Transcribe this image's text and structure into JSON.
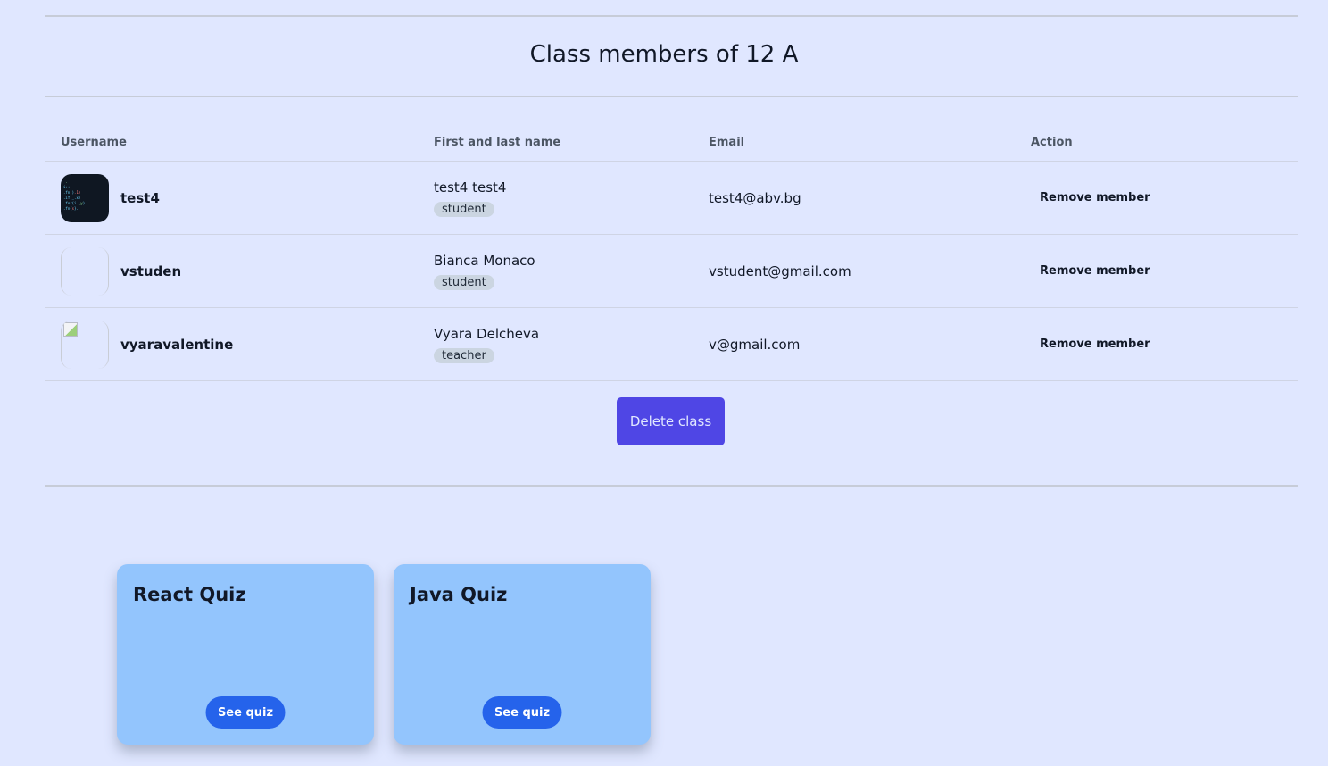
{
  "page": {
    "title": "Class members of 12 A"
  },
  "table": {
    "headers": {
      "username": "Username",
      "name": "First and last name",
      "email": "Email",
      "action": "Action"
    },
    "rows": [
      {
        "username": "test4",
        "full_name": "test4 test4",
        "role": "student",
        "email": "test4@abv.bg",
        "action_label": "Remove member",
        "avatar": "code-screenshot-avatar"
      },
      {
        "username": "vstuden",
        "full_name": "Bianca Monaco",
        "role": "student",
        "email": "vstudent@gmail.com",
        "action_label": "Remove member",
        "avatar": "empty-avatar"
      },
      {
        "username": "vyaravalentine",
        "full_name": "Vyara Delcheva",
        "role": "teacher",
        "email": "v@gmail.com",
        "action_label": "Remove member",
        "avatar": "broken-image-avatar"
      }
    ]
  },
  "delete_class_label": "Delete class",
  "quizzes": [
    {
      "title": "React Quiz",
      "button_label": "See quiz"
    },
    {
      "title": "Java Quiz",
      "button_label": "See quiz"
    }
  ],
  "colors": {
    "background": "#e0e7ff",
    "primary_button": "#4f46e5",
    "quiz_card": "#93c5fd",
    "quiz_button": "#2563eb",
    "role_badge": "#cbd5e1"
  }
}
